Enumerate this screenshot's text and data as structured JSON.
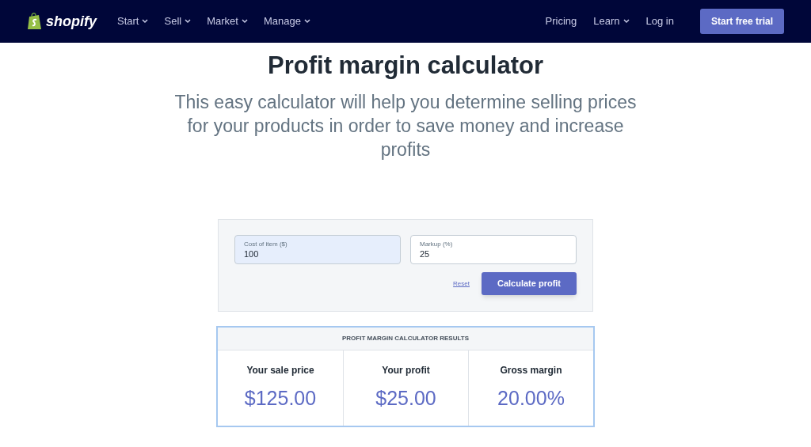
{
  "nav": {
    "brand": "shopify",
    "items": [
      {
        "label": "Start",
        "dropdown": true
      },
      {
        "label": "Sell",
        "dropdown": true
      },
      {
        "label": "Market",
        "dropdown": true
      },
      {
        "label": "Manage",
        "dropdown": true
      }
    ],
    "right_items": [
      {
        "label": "Pricing",
        "dropdown": false
      },
      {
        "label": "Learn",
        "dropdown": true
      },
      {
        "label": "Log in",
        "dropdown": false
      }
    ],
    "cta": "Start free trial"
  },
  "title": "Profit margin calculator",
  "subtitle": "This easy calculator will help you determine selling prices for your products in order to save money and increase profits",
  "form": {
    "fields": [
      {
        "label": "Cost of item ($)",
        "value": "100",
        "focused": true
      },
      {
        "label": "Markup (%)",
        "value": "25",
        "focused": false
      }
    ],
    "reset": "Reset",
    "submit": "Calculate profit"
  },
  "results": {
    "heading": "PROFIT MARGIN CALCULATOR RESULTS",
    "items": [
      {
        "label": "Your sale price",
        "value": "$125.00"
      },
      {
        "label": "Your profit",
        "value": "$25.00"
      },
      {
        "label": "Gross margin",
        "value": "20.00%"
      }
    ]
  }
}
